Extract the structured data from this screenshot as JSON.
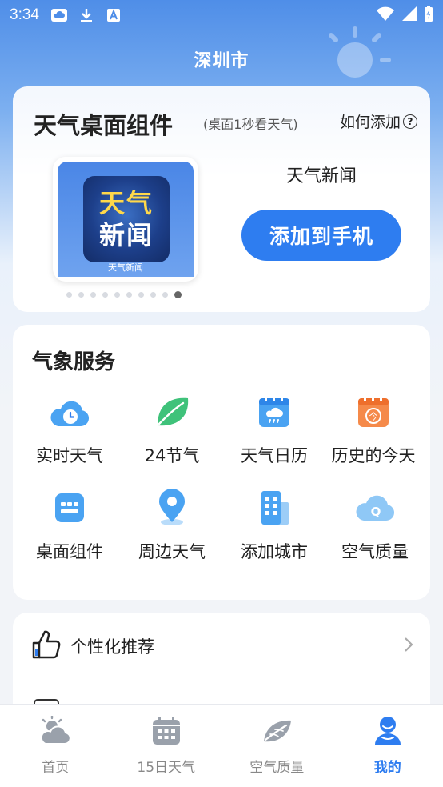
{
  "status_bar": {
    "time": "3:34"
  },
  "header": {
    "city": "深圳市"
  },
  "widget_card": {
    "title": "天气桌面组件",
    "subtitle": "(桌面1秒看天气)",
    "how_to_add": "如何添加",
    "preview": {
      "logo_line1": "天气",
      "logo_line2": "新闻",
      "label": "天气新闻"
    },
    "widget_name": "天气新闻",
    "add_button": "添加到手机",
    "page_count": 10,
    "active_page": 10
  },
  "services": {
    "title": "气象服务",
    "items": [
      {
        "label": "实时天气",
        "icon": "cloud-clock-icon"
      },
      {
        "label": "24节气",
        "icon": "leaf-icon"
      },
      {
        "label": "天气日历",
        "icon": "calendar-cloud-icon"
      },
      {
        "label": "历史的今天",
        "icon": "calendar-today-icon"
      },
      {
        "label": "桌面组件",
        "icon": "widget-grid-icon"
      },
      {
        "label": "周边天气",
        "icon": "location-pin-icon"
      },
      {
        "label": "添加城市",
        "icon": "building-icon"
      },
      {
        "label": "空气质量",
        "icon": "cloud-q-icon"
      }
    ]
  },
  "recommend": {
    "label": "个性化推荐"
  },
  "tabbar": {
    "tabs": [
      {
        "label": "首页",
        "icon": "home-weather-icon"
      },
      {
        "label": "15日天气",
        "icon": "calendar-icon"
      },
      {
        "label": "空气质量",
        "icon": "leaf-air-icon"
      },
      {
        "label": "我的",
        "icon": "profile-icon"
      }
    ],
    "active_tab": "我的"
  },
  "colors": {
    "accent": "#2e7df0",
    "header_bg": "#4f8ee8"
  }
}
